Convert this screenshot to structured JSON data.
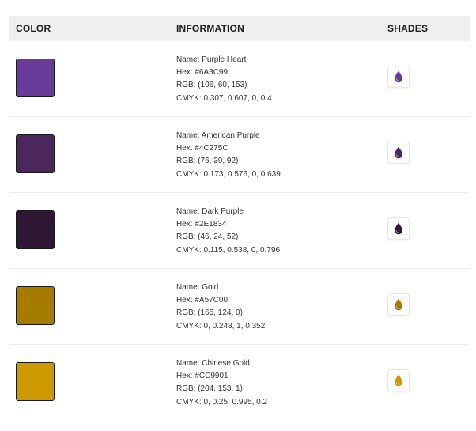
{
  "header": {
    "color": "COLOR",
    "information": "INFORMATION",
    "shades": "SHADES"
  },
  "colors": [
    {
      "swatch": "#6A3C99",
      "name": "Name: Purple Heart",
      "hex": "Hex: #6A3C99",
      "rgb": "RGB: (106, 60, 153)",
      "cmyk": "CMYK: 0.307, 0.607, 0, 0.4",
      "icon": "drop-icon"
    },
    {
      "swatch": "#4C275C",
      "name": "Name: American Purple",
      "hex": "Hex: #4C275C",
      "rgb": "RGB: (76, 39, 92)",
      "cmyk": "CMYK: 0.173, 0.576, 0, 0.639",
      "icon": "drop-icon"
    },
    {
      "swatch": "#2E1834",
      "name": "Name: Dark Purple",
      "hex": "Hex: #2E1834",
      "rgb": "RGB: (46, 24, 52)",
      "cmyk": "CMYK: 0.115, 0.538, 0, 0.796",
      "icon": "drop-icon"
    },
    {
      "swatch": "#A57C00",
      "name": "Name: Gold",
      "hex": "Hex: #A57C00",
      "rgb": "RGB: (165, 124, 0)",
      "cmyk": "CMYK: 0, 0.248, 1, 0.352",
      "icon": "drop-icon"
    },
    {
      "swatch": "#CC9901",
      "name": "Name: Chinese Gold",
      "hex": "Hex: #CC9901",
      "rgb": "RGB: (204, 153, 1)",
      "cmyk": "CMYK: 0, 0.25, 0.995, 0.2",
      "icon": "drop-icon"
    }
  ]
}
